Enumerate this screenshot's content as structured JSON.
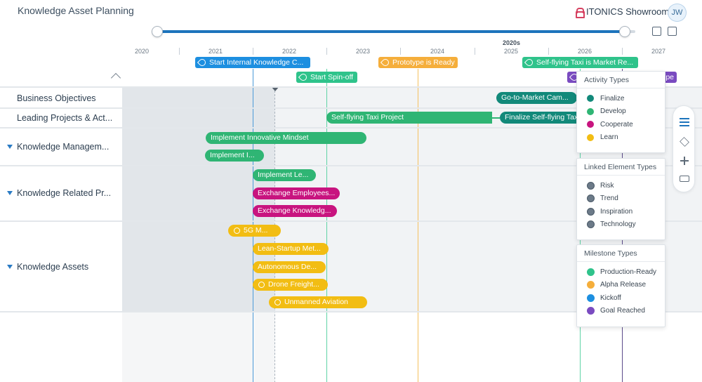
{
  "header": {
    "title": "Knowledge Asset Planning",
    "workspace": "ITONICS Showroom",
    "avatar_initials": "JW"
  },
  "timeline": {
    "decade_label": "2020s",
    "years": [
      "2020",
      "2021",
      "2022",
      "2023",
      "2024",
      "2025",
      "2026",
      "2027"
    ]
  },
  "milestones": [
    {
      "label": "Start Internal Knowledge C...",
      "color": "#1d8fe0"
    },
    {
      "label": "Prototype is Ready",
      "color": "#f5ae3b"
    },
    {
      "label": "Self-flying Taxi is Market Re...",
      "color": "#2fc38b"
    },
    {
      "label": "Start Spin-off",
      "color": "#2fc38b"
    },
    {
      "label": "pe",
      "color": "#7a4bc0"
    }
  ],
  "rows": [
    {
      "label": "Business Objectives",
      "expandable": false
    },
    {
      "label": "Leading Projects & Act...",
      "expandable": false
    },
    {
      "label": "Knowledge Managem...",
      "expandable": true
    },
    {
      "label": "Knowledge Related Pr...",
      "expandable": true
    },
    {
      "label": "Knowledge Assets",
      "expandable": true
    }
  ],
  "bars": [
    {
      "label": "Go-to-Market Cam...",
      "color": "#12897a"
    },
    {
      "label": "Self-flying Taxi Project",
      "color": "#2fb574"
    },
    {
      "label": "Finalize Self-flying Taxi",
      "color": "#12897a"
    },
    {
      "label": "Implement Innovative Mindset",
      "color": "#2fb574"
    },
    {
      "label": "Implement I...",
      "color": "#2fb574"
    },
    {
      "label": "Implement Le...",
      "color": "#2fb574"
    },
    {
      "label": "Exchange Employees...",
      "color": "#c8147f"
    },
    {
      "label": "Exchange Knowledg...",
      "color": "#c8147f"
    },
    {
      "label": "5G M...",
      "color": "#f2bd13"
    },
    {
      "label": "Lean-Startup Met...",
      "color": "#f2bd13"
    },
    {
      "label": "Autonomous De...",
      "color": "#f2bd13"
    },
    {
      "label": "Drone Freight...",
      "color": "#f2bd13"
    },
    {
      "label": "Unmanned Aviation",
      "color": "#f2bd13"
    }
  ],
  "legend": {
    "activity": {
      "title": "Activity Types",
      "items": [
        {
          "label": "Finalize",
          "color": "#12897a"
        },
        {
          "label": "Develop",
          "color": "#2fb574"
        },
        {
          "label": "Cooperate",
          "color": "#c8147f"
        },
        {
          "label": "Learn",
          "color": "#f2bd13"
        }
      ]
    },
    "linked": {
      "title": "Linked Element Types",
      "items": [
        {
          "label": "Risk",
          "icon": "risk-icon"
        },
        {
          "label": "Trend",
          "icon": "trend-icon"
        },
        {
          "label": "Inspiration",
          "icon": "inspiration-icon"
        },
        {
          "label": "Technology",
          "icon": "technology-icon"
        }
      ]
    },
    "milestone": {
      "title": "Milestone Types",
      "items": [
        {
          "label": "Production-Ready",
          "color": "#2fc38b"
        },
        {
          "label": "Alpha Release",
          "color": "#f5ae3b"
        },
        {
          "label": "Kickoff",
          "color": "#1d8fe0"
        },
        {
          "label": "Goal Reached",
          "color": "#7a4bc0"
        }
      ]
    }
  }
}
